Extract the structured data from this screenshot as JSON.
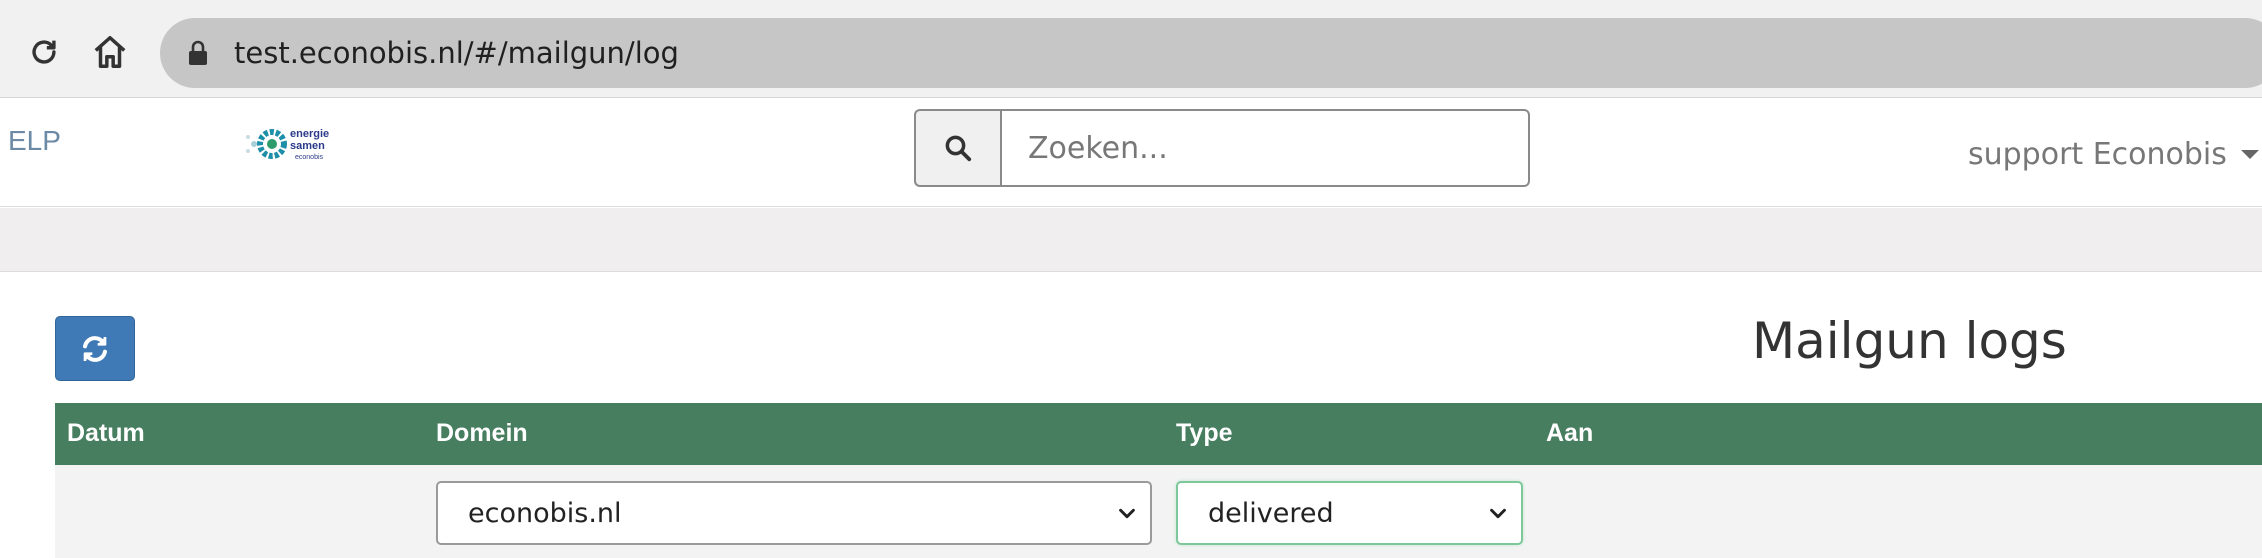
{
  "browser": {
    "url": "test.econobis.nl/#/mailgun/log"
  },
  "header": {
    "app_name": "ELP",
    "logo_text": [
      "energie",
      "samen",
      "econobis"
    ],
    "search_placeholder": "Zoeken...",
    "user_name": "support Econobis"
  },
  "page": {
    "title": "Mailgun logs"
  },
  "table": {
    "columns": [
      "Datum",
      "Domein",
      "Type",
      "Aan"
    ]
  },
  "filters": {
    "domain_value": "econobis.nl",
    "type_value": "delivered"
  },
  "colors": {
    "table_header": "#467e5f",
    "refresh_button": "#3f7ab6",
    "app_name": "#6b8aa5"
  },
  "icons": {
    "reload": "reload-icon",
    "home": "home-icon",
    "lock": "lock-icon",
    "search": "search-icon",
    "refresh": "refresh-icon",
    "dropdown": "chevron-down-icon"
  }
}
